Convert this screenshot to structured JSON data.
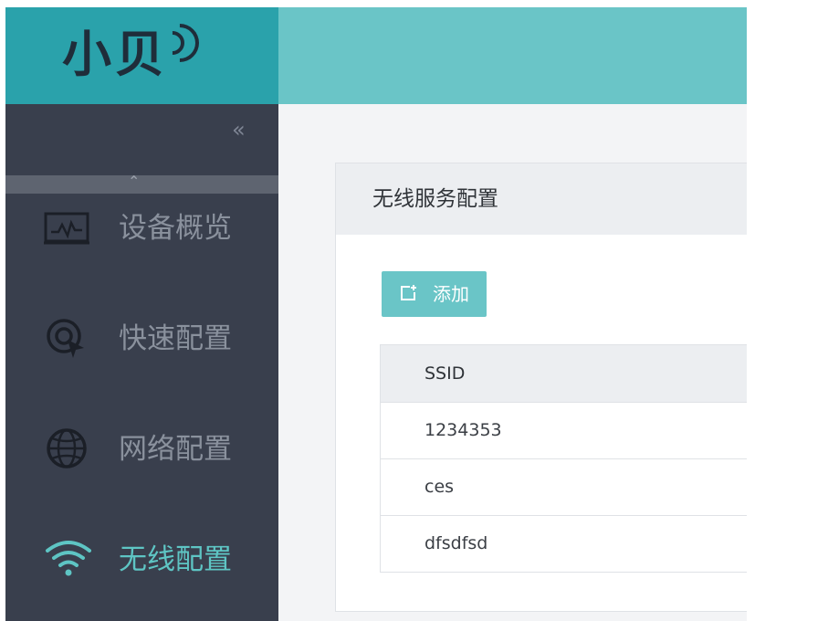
{
  "logo": {
    "text": "小贝"
  },
  "sidebar": {
    "collapse_icon": "«",
    "scroll_up_icon": "^",
    "items": [
      {
        "label": "设备概览",
        "icon": "monitor-chart-icon",
        "active": false
      },
      {
        "label": "快速配置",
        "icon": "quick-target-icon",
        "active": false
      },
      {
        "label": "网络配置",
        "icon": "globe-icon",
        "active": false
      },
      {
        "label": "无线配置",
        "icon": "wifi-icon",
        "active": true
      }
    ]
  },
  "colors": {
    "accent": "#6ac5c7",
    "logo_bg": "#2aa2ab",
    "sidebar_bg": "#393f4d",
    "active_text": "#5ec5c4"
  },
  "card": {
    "title": "无线服务配置",
    "add_button": {
      "label": "添加",
      "icon": "add-square-icon"
    },
    "table": {
      "columns": [
        "SSID"
      ],
      "rows": [
        [
          "1234353"
        ],
        [
          "ces"
        ],
        [
          "dfsdfsd"
        ]
      ]
    }
  }
}
